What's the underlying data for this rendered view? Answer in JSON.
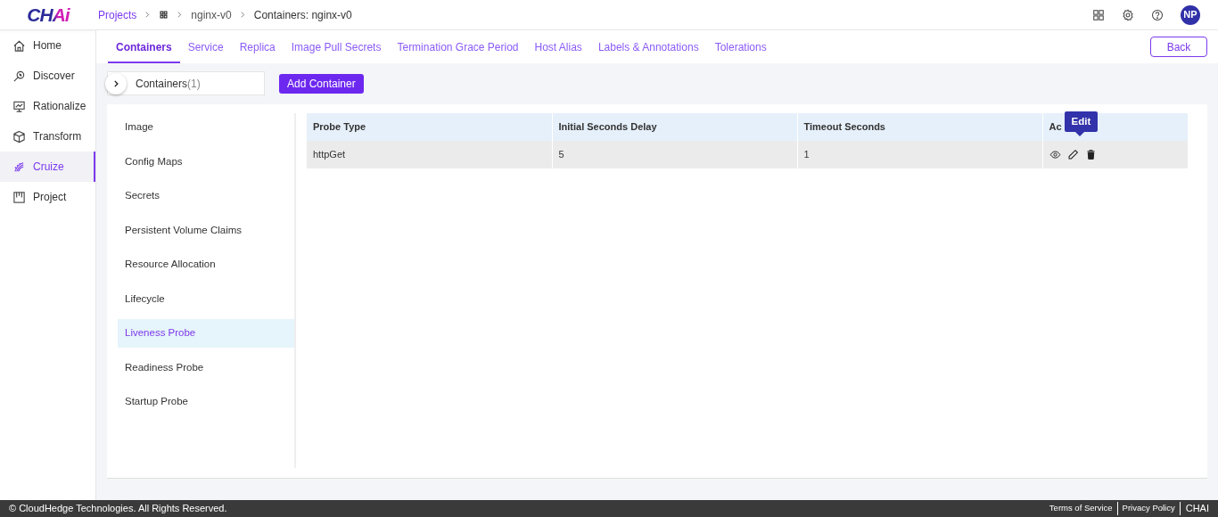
{
  "logo": "CHAi",
  "breadcrumb": [
    {
      "label": "Projects",
      "kind": "link"
    },
    {
      "kind": "icon"
    },
    {
      "label": "nginx-v0",
      "kind": "plain"
    },
    {
      "label": "Containers: nginx-v0",
      "kind": "current"
    }
  ],
  "user": {
    "initials": "NP"
  },
  "sidebar": {
    "items": [
      {
        "label": "Home",
        "selected": false
      },
      {
        "label": "Discover",
        "selected": false
      },
      {
        "label": "Rationalize",
        "selected": false
      },
      {
        "label": "Transform",
        "selected": false
      },
      {
        "label": "Cruize",
        "selected": true
      },
      {
        "label": "Project",
        "selected": false
      }
    ]
  },
  "tabs": [
    {
      "label": "Containers",
      "selected": true
    },
    {
      "label": "Service",
      "selected": false
    },
    {
      "label": "Replica",
      "selected": false
    },
    {
      "label": "Image Pull Secrets",
      "selected": false
    },
    {
      "label": "Termination Grace Period",
      "selected": false
    },
    {
      "label": "Host Alias",
      "selected": false
    },
    {
      "label": "Labels & Annotations",
      "selected": false
    },
    {
      "label": "Tolerations",
      "selected": false
    }
  ],
  "back_button": "Back",
  "containers": {
    "label": "Containers",
    "count": "(1)",
    "add_button": "Add Container"
  },
  "sections": [
    {
      "label": "Image",
      "selected": false
    },
    {
      "label": "Config Maps",
      "selected": false
    },
    {
      "label": "Secrets",
      "selected": false
    },
    {
      "label": "Persistent Volume Claims",
      "selected": false
    },
    {
      "label": "Resource Allocation",
      "selected": false
    },
    {
      "label": "Lifecycle",
      "selected": false
    },
    {
      "label": "Liveness Probe",
      "selected": true
    },
    {
      "label": "Readiness Probe",
      "selected": false
    },
    {
      "label": "Startup Probe",
      "selected": false
    }
  ],
  "table": {
    "columns": [
      "Probe Type",
      "Initial Seconds Delay",
      "Timeout Seconds",
      "Ac"
    ],
    "rows": [
      {
        "cells": [
          "httpGet",
          "5",
          "1"
        ]
      }
    ]
  },
  "tooltip": "Edit",
  "footer": {
    "copyright": "© CloudHedge Technologies. All Rights Reserved.",
    "links": [
      "Terms of Service",
      "Privacy Policy"
    ],
    "brand": "CHAI"
  }
}
